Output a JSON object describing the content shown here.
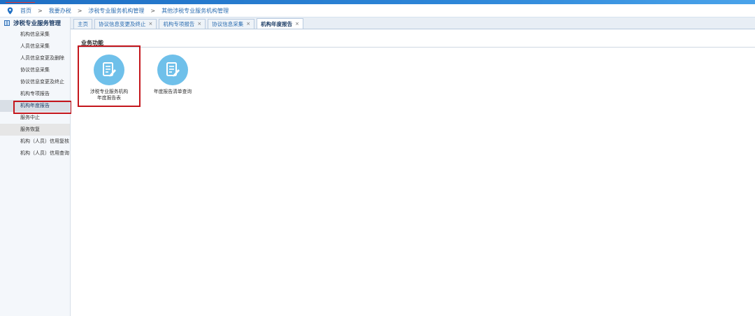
{
  "breadcrumb": {
    "items": [
      "首页",
      "我要办税",
      "涉税专业服务机构管理",
      "其他涉税专业服务机构管理"
    ],
    "separator": ">"
  },
  "sidebar": {
    "title": "涉税专业服务管理",
    "items": [
      {
        "label": "机构信息采集"
      },
      {
        "label": "人员信息采集"
      },
      {
        "label": "人员信息变更及删除"
      },
      {
        "label": "协议信息采集"
      },
      {
        "label": "协议信息变更及终止"
      },
      {
        "label": "机构专项报告"
      },
      {
        "label": "机构年度报告"
      },
      {
        "label": "服务中止"
      },
      {
        "label": "服务恢复"
      },
      {
        "label": "机构（人员）信用复核"
      },
      {
        "label": "机构（人员）信用查询"
      }
    ]
  },
  "tabs": [
    {
      "label": "主页",
      "closable": false
    },
    {
      "label": "协议信息变更及终止",
      "closable": true
    },
    {
      "label": "机构专项报告",
      "closable": true
    },
    {
      "label": "协议信息采集",
      "closable": true
    },
    {
      "label": "机构年度报告",
      "closable": true,
      "active": true
    }
  ],
  "tab_close_glyph": "×",
  "main": {
    "section_title": "业务功能",
    "functions": [
      {
        "line1": "涉税专业服务机构",
        "line2": "年度报告表"
      },
      {
        "line1": "年度报告清单查询",
        "line2": ""
      }
    ]
  },
  "colors": {
    "accent": "#2b6cb0",
    "icon_circle": "#6fc0ea",
    "highlight_box": "#c4161c"
  },
  "icons": {
    "breadcrumb": "location-pin-icon",
    "sidebar_header": "grid-icon",
    "function": "edit-document-icon"
  }
}
